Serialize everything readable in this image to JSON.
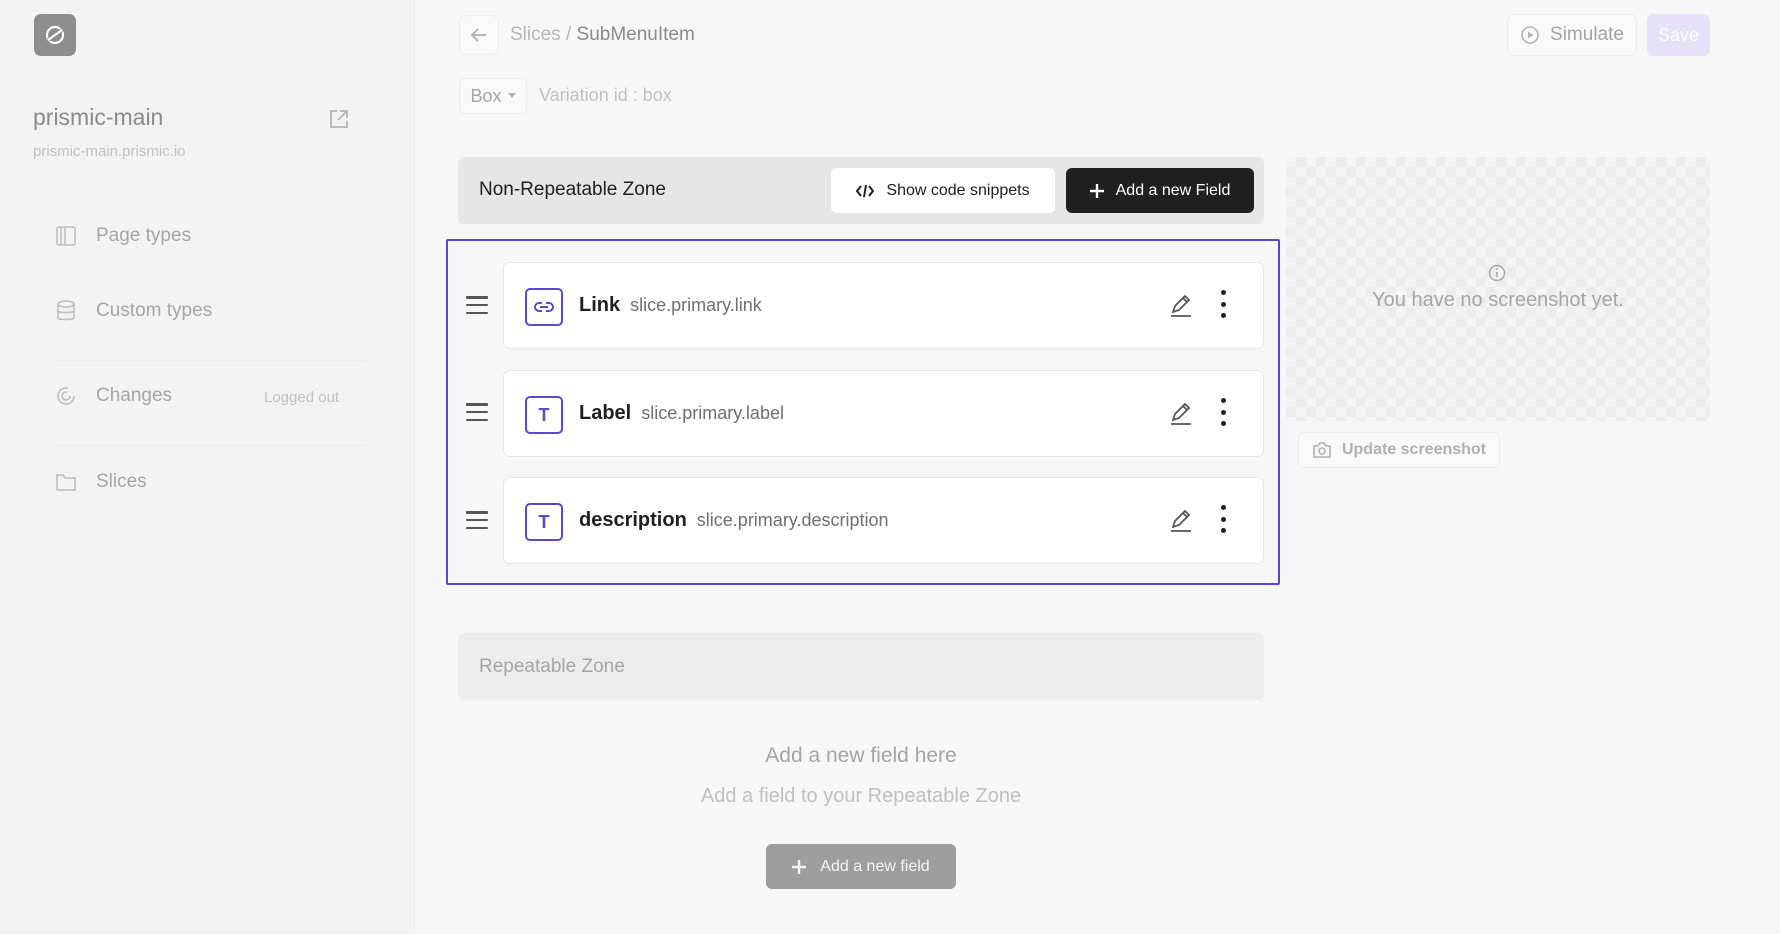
{
  "sidebar": {
    "repo_name": "prismic-main",
    "repo_url": "prismic-main.prismic.io",
    "items": [
      {
        "label": "Page types",
        "icon": "page-types-icon"
      },
      {
        "label": "Custom types",
        "icon": "database-icon"
      },
      {
        "label": "Changes",
        "icon": "changes-icon",
        "status": "Logged out"
      },
      {
        "label": "Slices",
        "icon": "folder-icon"
      }
    ]
  },
  "header": {
    "breadcrumb_parent": "Slices",
    "breadcrumb_sep": " / ",
    "breadcrumb_current": "SubMenuItem",
    "simulate_label": "Simulate",
    "save_label": "Save"
  },
  "variation": {
    "selected": "Box",
    "id_text": "Variation id : box"
  },
  "non_repeatable": {
    "title": "Non-Repeatable Zone",
    "code_label": "Show code snippets",
    "add_label": "Add a new Field",
    "fields": [
      {
        "type": "link",
        "name": "Link",
        "api": "slice.primary.link"
      },
      {
        "type": "text",
        "type_glyph": "T",
        "name": "Label",
        "api": "slice.primary.label"
      },
      {
        "type": "text",
        "type_glyph": "T",
        "name": "description",
        "api": "slice.primary.description"
      }
    ]
  },
  "screenshot": {
    "empty_text": "You have no screenshot yet.",
    "update_label": "Update screenshot"
  },
  "repeatable": {
    "title": "Repeatable Zone",
    "empty_title": "Add a new field here",
    "empty_sub": "Add a field to your Repeatable Zone",
    "add_label": "Add a new field"
  },
  "colors": {
    "accent": "#5b47c9",
    "dark_button": "#202020",
    "save_disabled": "#e6e1f8"
  }
}
